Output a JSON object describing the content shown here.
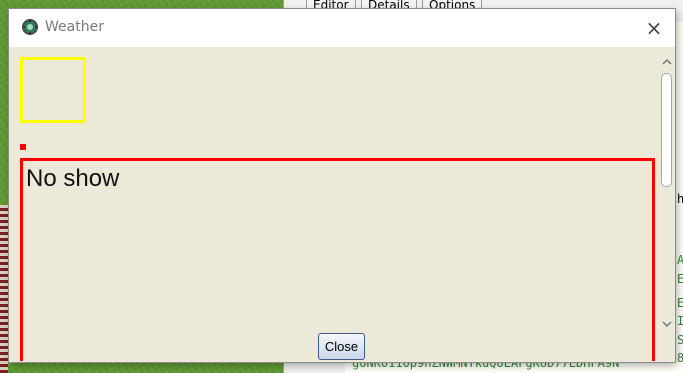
{
  "background": {
    "editor_tabs": [
      "Editor",
      "Details",
      "Options"
    ],
    "code_lines": [
      "h",
      "A",
      "E",
      "E",
      "I",
      "S",
      "8",
      "gONK0110p9nZNWMNYkuQUEAFgKUD77EDHFA9N"
    ]
  },
  "dialog": {
    "title": "Weather",
    "close_glyph": "×",
    "panel_text": "No show",
    "close_button_label": "Close"
  },
  "colors": {
    "highlight_box": "#ffff00",
    "panel_border": "#ff0000",
    "dialog_bg": "#ece9d8"
  },
  "icons": {
    "app": "weather-app-icon",
    "close": "close-icon",
    "scroll_up": "chevron-up-icon",
    "scroll_down": "chevron-down-icon"
  }
}
